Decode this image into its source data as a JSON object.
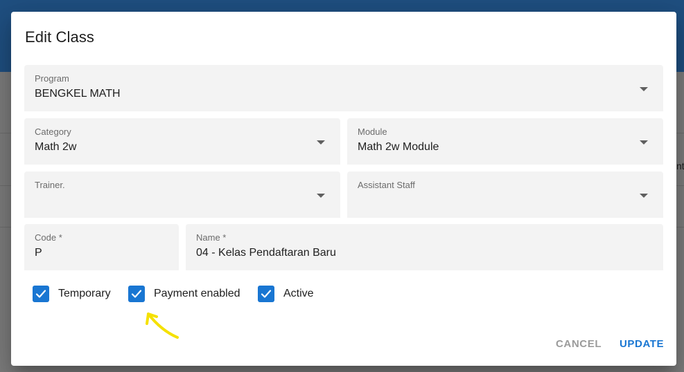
{
  "background": {
    "peek_text": "nt"
  },
  "dialog": {
    "title": "Edit Class",
    "fields": {
      "program": {
        "label": "Program",
        "value": "BENGKEL MATH"
      },
      "category": {
        "label": "Category",
        "value": "Math 2w"
      },
      "module": {
        "label": "Module",
        "value": "Math 2w Module"
      },
      "trainer": {
        "label": "Trainer.",
        "value": ""
      },
      "assistant": {
        "label": "Assistant Staff",
        "value": ""
      },
      "code": {
        "label": "Code *",
        "value": "P"
      },
      "name": {
        "label": "Name *",
        "value": "04 - Kelas Pendaftaran Baru"
      }
    },
    "checkboxes": [
      {
        "label": "Temporary",
        "checked": true
      },
      {
        "label": "Payment enabled",
        "checked": true
      },
      {
        "label": "Active",
        "checked": true
      }
    ],
    "actions": {
      "cancel": "CANCEL",
      "update": "UPDATE"
    }
  },
  "colors": {
    "primary": "#1976d2",
    "annotation": "#f5e100",
    "topbar": "#1f4f80"
  }
}
